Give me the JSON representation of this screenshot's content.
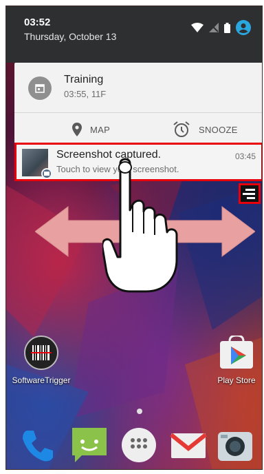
{
  "status_bar": {
    "time": "03:52",
    "date": "Thursday, October 13"
  },
  "notifications": [
    {
      "title": "Training",
      "subtitle": "03:55, 11F",
      "actions": [
        {
          "label": "MAP",
          "icon": "location-pin-icon"
        },
        {
          "label": "SNOOZE",
          "icon": "alarm-clock-icon"
        }
      ]
    },
    {
      "title": "Screenshot captured.",
      "subtitle": "Touch to view your screenshot.",
      "time": "03:45"
    }
  ],
  "home_apps": [
    {
      "label": "SoftwareTrigger",
      "icon": "barcode-icon"
    },
    {
      "label": "Play Store",
      "icon": "play-store-icon"
    }
  ],
  "dock": [
    "phone-icon",
    "messaging-icon",
    "app-drawer-icon",
    "gmail-icon",
    "camera-icon"
  ],
  "colors": {
    "highlight": "#e8000b",
    "shade_header": "#2d2f31",
    "card": "#f2f2f2",
    "accent_blue": "#2aa7df",
    "swipe_arrow": "#e8a0a0"
  }
}
